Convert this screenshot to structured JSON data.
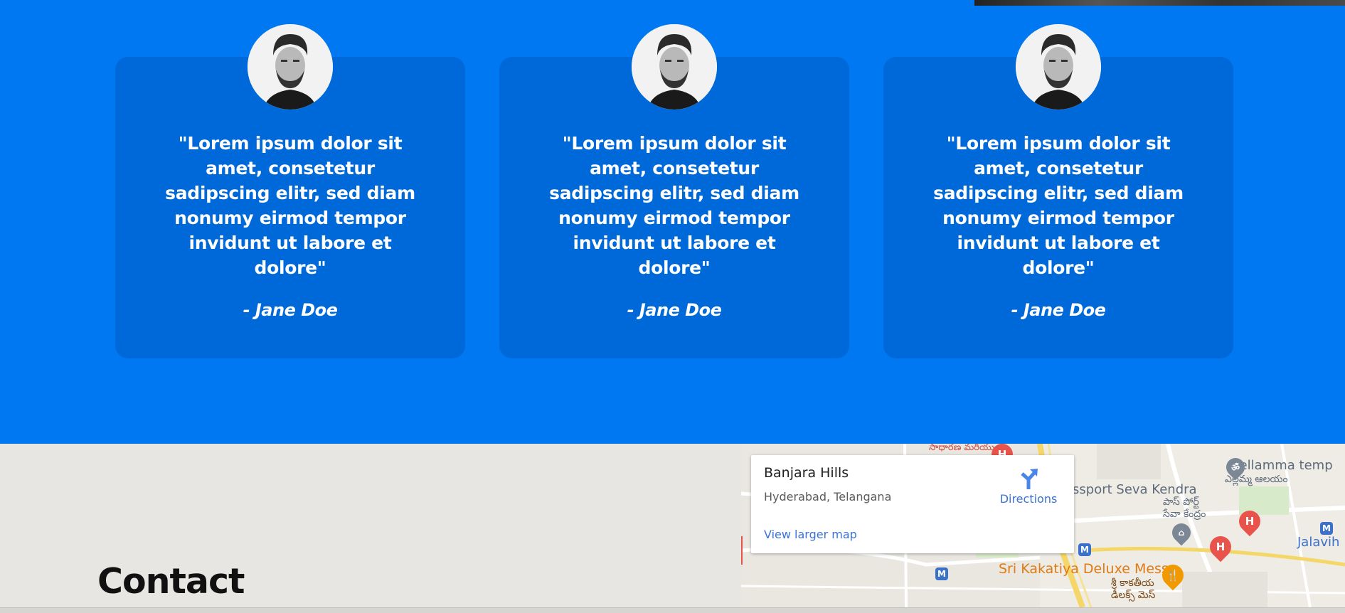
{
  "testimonials": {
    "cards": [
      {
        "quote": "\"Lorem ipsum dolor sit amet, consetetur sadipscing elitr, sed diam nonumy eirmod tempor invidunt ut labore et dolore\"",
        "author": "- Jane Doe"
      },
      {
        "quote": "\"Lorem ipsum dolor sit amet, consetetur sadipscing elitr, sed diam nonumy eirmod tempor invidunt ut labore et dolore\"",
        "author": "- Jane Doe"
      },
      {
        "quote": "\"Lorem ipsum dolor sit amet, consetetur sadipscing elitr, sed diam nonumy eirmod tempor invidunt ut labore et dolore\"",
        "author": "- Jane Doe"
      }
    ]
  },
  "contact": {
    "title": "Contact"
  },
  "map": {
    "place_name": "Banjara Hills",
    "address": "Hyderabad, Telangana",
    "directions_label": "Directions",
    "view_larger_label": "View larger map",
    "labels": {
      "top_partial": "సాధారణ మరియు...",
      "passport": "assport Seva Kendra",
      "passport_te": "పాస్ పోర్ట్ సేవా కేంద్రం",
      "yellamma": "Yellamma temp",
      "yellamma_te": "ఎల్లమ్మ ఆలయం",
      "jalavihar": "Jalavih",
      "mess": "Sri Kakatiya Deluxe Mess",
      "mess_te": "శ్రీ కాకతీయ డీలక్స్ మెస్"
    },
    "pin_h": "H",
    "metro": "M",
    "colors": {
      "hospital_pin": "#e8544b",
      "food_pin": "#f29900",
      "link": "#3a72d6"
    }
  },
  "colors": {
    "section_bg": "#0078f1",
    "card_bg": "#0069d9",
    "contact_bg": "#e8e6e3"
  }
}
